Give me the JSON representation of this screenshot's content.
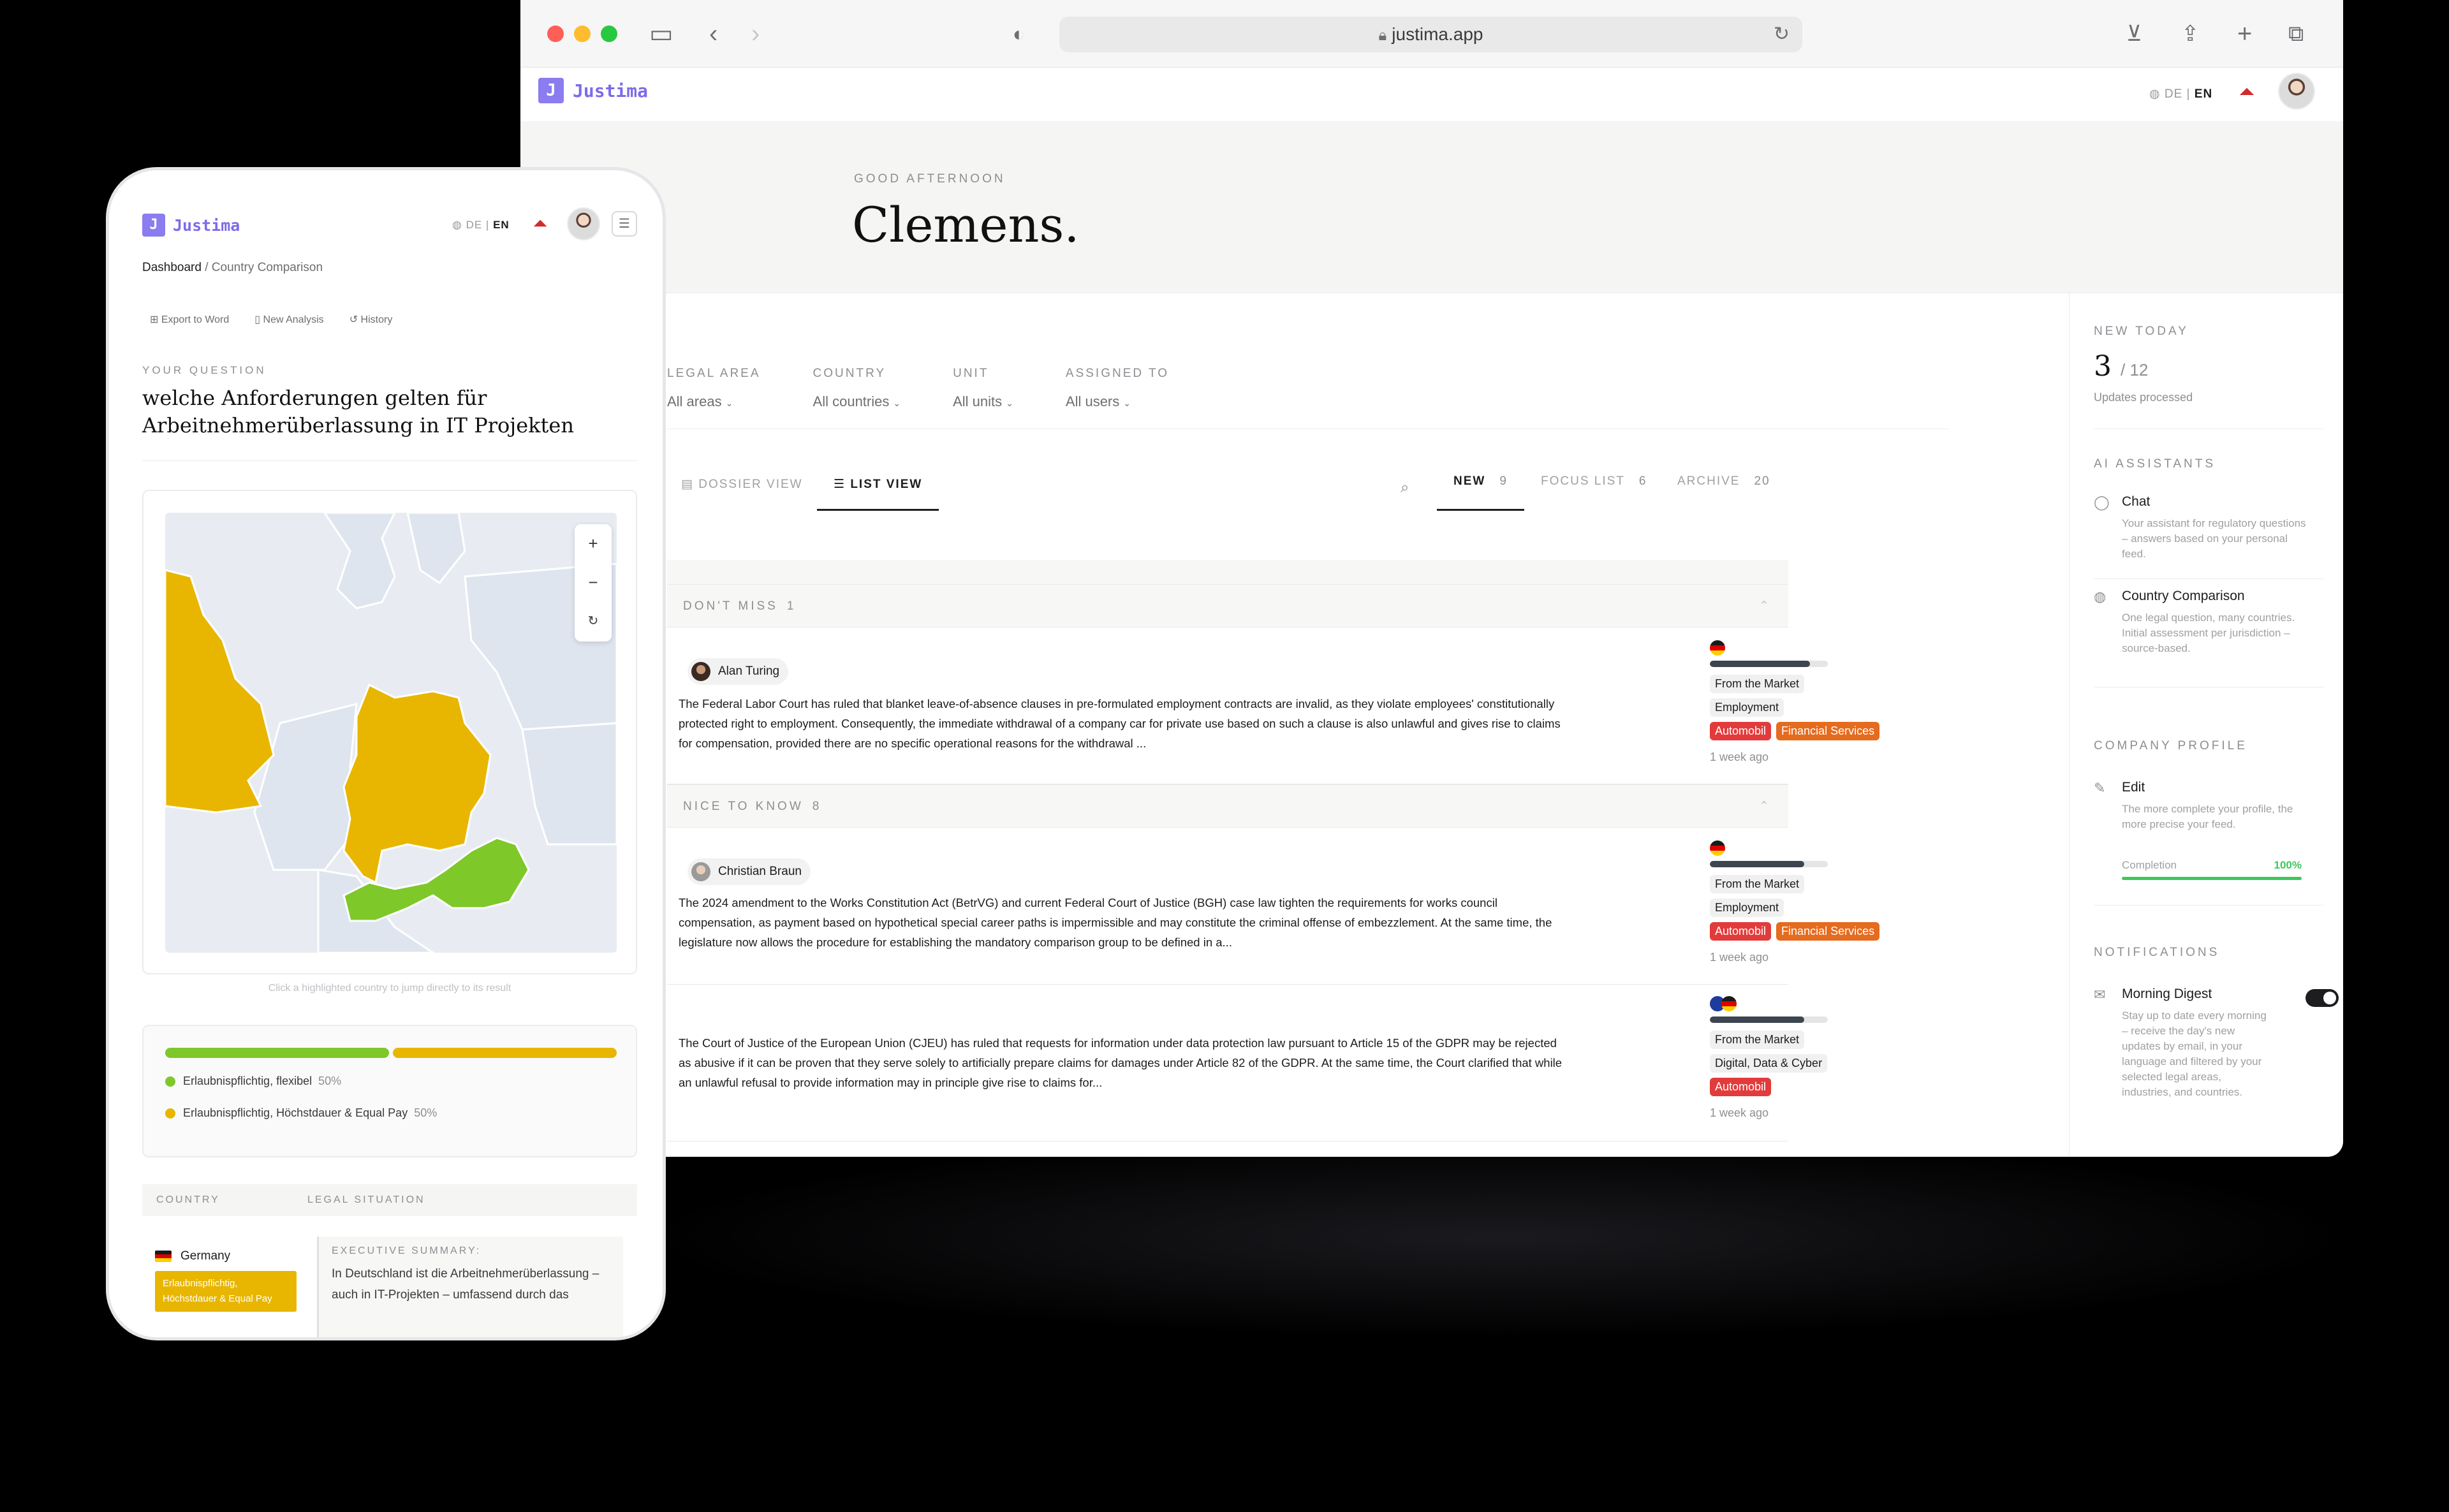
{
  "browser": {
    "url": "justima.app"
  },
  "app": {
    "brand_mark": "J",
    "brand_name": "Justima",
    "lang_de": "DE",
    "lang_sep": "|",
    "lang_en": "EN"
  },
  "greeting": {
    "small": "GOOD AFTERNOON",
    "name": "Clemens."
  },
  "filters": [
    {
      "label": "LEGAL AREA",
      "value": "All areas"
    },
    {
      "label": "COUNTRY",
      "value": "All countries"
    },
    {
      "label": "UNIT",
      "value": "All units"
    },
    {
      "label": "ASSIGNED TO",
      "value": "All users"
    }
  ],
  "views": {
    "dossier": "DOSSIER VIEW",
    "list": "LIST VIEW"
  },
  "feed_tabs": [
    {
      "label": "NEW",
      "count": "9"
    },
    {
      "label": "FOCUS LIST",
      "count": "6"
    },
    {
      "label": "ARCHIVE",
      "count": "20"
    }
  ],
  "sections": {
    "dont_miss": {
      "label": "DON'T MISS",
      "count": "1"
    },
    "nice_to_know": {
      "label": "NICE TO KNOW",
      "count": "8"
    }
  },
  "items": [
    {
      "author": "Alan Turing",
      "text": "The Federal Labor Court has ruled that blanket leave-of-absence clauses in pre-formulated employment contracts are invalid, as they violate employees' constitutionally protected right to employment. Consequently, the immediate withdrawal of a company car for private use based on such a clause is also unlawful and gives rise to claims for compensation, provided there are no specific operational reasons for the withdrawal ...",
      "source": "From the Market",
      "area": "Employment",
      "tags": [
        "Automobil",
        "Financial Services"
      ],
      "ago": "1 week ago",
      "relevance": 0.85
    },
    {
      "author": "Christian Braun",
      "text": "The 2024 amendment to the Works Constitution Act (BetrVG) and current Federal Court of Justice (BGH) case law tighten the requirements for works council compensation, as payment based on hypothetical special career paths is impermissible and may constitute the criminal offense of embezzlement. At the same time, the legislature now allows the procedure for establishing the mandatory comparison group to be defined in a...",
      "source": "From the Market",
      "area": "Employment",
      "tags": [
        "Automobil",
        "Financial Services"
      ],
      "ago": "1 week ago",
      "relevance": 0.8
    },
    {
      "text": "The Court of Justice of the European Union (CJEU) has ruled that requests for information under data protection law pursuant to Article 15 of the GDPR may be rejected as abusive if it can be proven that they serve solely to artificially prepare claims for damages under Article 82 of the GDPR. At the same time, the Court clarified that while an unlawful refusal to provide information may in principle give rise to claims for...",
      "source": "From the Market",
      "area": "Digital, Data & Cyber",
      "tags": [
        "Automobil"
      ],
      "ago": "1 week ago",
      "relevance": 0.8
    }
  ],
  "right_panel": {
    "new_today_label": "NEW TODAY",
    "new_today_value": "3",
    "new_today_total": "/ 12",
    "new_today_caption": "Updates processed",
    "ai_label": "AI ASSISTANTS",
    "chat_title": "Chat",
    "chat_desc": "Your assistant for regulatory questions – answers based on your personal feed.",
    "cc_title": "Country Comparison",
    "cc_desc": "One legal question, many countries. Initial assessment per jurisdiction – source-based.",
    "profile_label": "COMPANY PROFILE",
    "edit_title": "Edit",
    "edit_desc": "The more complete your profile, the more precise your feed.",
    "completion_label": "Completion",
    "completion_value": "100%",
    "notif_label": "NOTIFICATIONS",
    "digest_title": "Morning Digest",
    "digest_desc": "Stay up to date every morning – receive the day's new updates by email, in your language and filtered by your selected legal areas, industries, and countries.",
    "digest_on": true
  },
  "mobile": {
    "crumb_root": "Dashboard",
    "crumb_sep": "/",
    "crumb_current": "Country Comparison",
    "export": "Export to Word",
    "new_analysis": "New Analysis",
    "history": "History",
    "question_label": "YOUR QUESTION",
    "question": "welche Anforderungen gelten für Arbeitnehmerüberlassung in IT Projekten",
    "map_hint": "Click a highlighted country to jump directly to its result",
    "legend": [
      {
        "label": "Erlaubnispflichtig, flexibel",
        "pct": "50%",
        "color": "#7ec82a",
        "share": 0.5
      },
      {
        "label": "Erlaubnispflichtig, Höchstdauer & Equal Pay",
        "pct": "50%",
        "color": "#e8b600",
        "share": 0.5
      }
    ],
    "col_country": "COUNTRY",
    "col_legal": "LEGAL SITUATION",
    "row_country": "Germany",
    "row_status": "Erlaubnispflichtig, Höchstdauer & Equal Pay",
    "summary_label": "EXECUTIVE SUMMARY:",
    "summary_text": "In Deutschland ist die Arbeitnehmerüberlassung – auch in IT-Projekten – umfassend durch das"
  },
  "colors": {
    "brand": "#8b7cf0",
    "tag_red": "#e23b3b",
    "tag_orange": "#e56b1f",
    "map_yellow": "#e8b600",
    "map_green": "#7ec82a",
    "completion_green": "#3cc85a"
  }
}
